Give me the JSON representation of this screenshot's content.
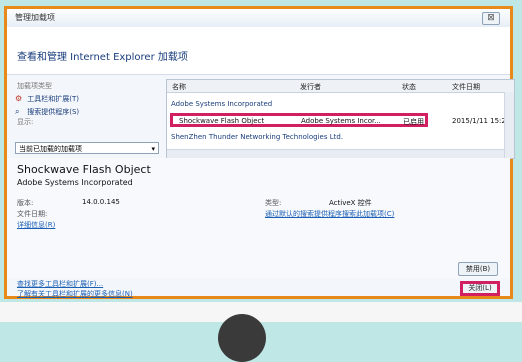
{
  "dialog": {
    "title": "管理加载项",
    "close_glyph": "⊠",
    "header": "查看和管理 Internet Explorer 加载项"
  },
  "left": {
    "type_label": "加载项类型",
    "items": [
      {
        "label": "工具栏和扩展(T)",
        "icon": "⚙"
      },
      {
        "label": "搜索提供程序(S)",
        "icon": "⌕"
      }
    ],
    "show_label": "显示:",
    "show_value": "当前已加载的加载项",
    "dropdown_arrow": "▾"
  },
  "list": {
    "columns": [
      "名称",
      "发行者",
      "状态",
      "文件日期"
    ],
    "groups": [
      "Adobe Systems Incorporated",
      "ShenZhen Thunder Networking Technologies Ltd."
    ],
    "selected_item": {
      "name": "Shockwave Flash Object",
      "publisher": "Adobe Systems Incor...",
      "status": "已启用",
      "date": "2015/1/11 15:2"
    }
  },
  "details": {
    "name": "Shockwave Flash Object",
    "vendor": "Adobe Systems Incorporated",
    "version_label": "版本:",
    "version_value": "14.0.0.145",
    "filedate_label": "文件日期:",
    "more_info_link": "详细信息(R)",
    "type_label": "类型:",
    "type_value": "ActiveX 控件",
    "search_link": "通过默认的搜索提供程序搜索此加载项(C)",
    "disable_button": "禁用(B)"
  },
  "footer": {
    "link1": "查找更多工具栏和扩展(F)...",
    "link2": "了解有关工具栏和扩展的更多信息(N)",
    "close_button": "关闭(L)"
  },
  "colors": {
    "highlight": "#d11f62",
    "frame": "#e88a1a",
    "link": "#1a5fb4"
  }
}
